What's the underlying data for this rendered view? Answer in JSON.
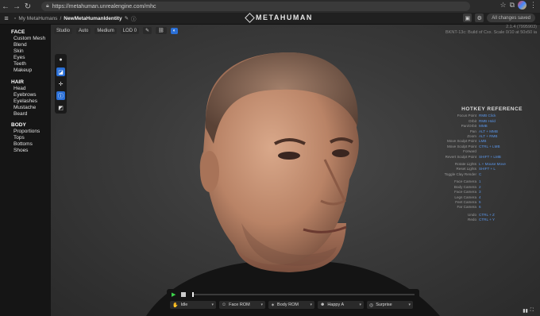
{
  "browser": {
    "url": "https://metahuman.unrealengine.com/mhc",
    "back": "←",
    "forward": "→",
    "reload": "↻",
    "icons": [
      "star-icon",
      "extension-icon",
      "menu-icon"
    ]
  },
  "header": {
    "breadcrumb_root": "My MetaHumans",
    "separator": "/",
    "breadcrumb_current": "NewMetaHumanIdentity",
    "logo": "METAHUMAN",
    "saved_label": "All changes saved"
  },
  "sidebar": {
    "sections": [
      {
        "title": "FACE",
        "items": [
          "Custom Mesh",
          "Blend",
          "Skin",
          "Eyes",
          "Teeth",
          "Makeup"
        ]
      },
      {
        "title": "HAIR",
        "items": [
          "Head",
          "Eyebrows",
          "Eyelashes",
          "Mustache",
          "Beard"
        ]
      },
      {
        "title": "BODY",
        "items": [
          "Proportions",
          "Tops",
          "Bottoms",
          "Shoes"
        ]
      }
    ]
  },
  "viewport_toolbar": {
    "lighting": "Studio",
    "camera": "Auto",
    "quality": "Medium",
    "lod": "LOD 0"
  },
  "version": {
    "line1": "2.1.4 (7995903)",
    "line2": "BKNT-13c: Build of Cxx. Scale 0/10 at 50x50 ia"
  },
  "hotkeys": {
    "title": "HOTKEY REFERENCE",
    "groups": [
      [
        {
          "action": "Focus Point",
          "key": "RMB Click"
        },
        {
          "action": "Orbit",
          "key": "RMB Hold"
        },
        {
          "action": "Pan/Orbit",
          "key": "MMB"
        },
        {
          "action": "Pan",
          "key": "ALT + MMB"
        },
        {
          "action": "Zoom",
          "key": "ALT + RMB"
        },
        {
          "action": "Move Sculpt Point",
          "key": "LMB"
        },
        {
          "action": "Move Sculpt Point Forward",
          "key": "CTRL + LMB"
        },
        {
          "action": "Revert Sculpt Point",
          "key": "SHIFT + LMB"
        }
      ],
      [
        {
          "action": "Rotate Lights",
          "key": "L + Mouse Move"
        },
        {
          "action": "Reset Lights",
          "key": "SHIFT + L"
        },
        {
          "action": "Toggle Clay Render",
          "key": "C"
        }
      ],
      [
        {
          "action": "Face Camera",
          "key": "1"
        },
        {
          "action": "Body Camera",
          "key": "2"
        },
        {
          "action": "Face Camera",
          "key": "3"
        },
        {
          "action": "Legs Camera",
          "key": "4"
        },
        {
          "action": "Feet Camera",
          "key": "5"
        },
        {
          "action": "Far Camera",
          "key": "6"
        }
      ],
      [
        {
          "action": "Undo",
          "key": "CTRL + Z"
        },
        {
          "action": "Redo",
          "key": "CTRL + Y"
        }
      ]
    ]
  },
  "animation": {
    "chips": [
      {
        "label": "Idle",
        "icon": "person-icon"
      },
      {
        "label": "Face ROM",
        "icon": "face-icon"
      },
      {
        "label": "Body ROM",
        "icon": "body-icon"
      },
      {
        "label": "Happy A",
        "icon": "happy-icon"
      },
      {
        "label": "Surprise",
        "icon": "surprise-icon"
      }
    ]
  },
  "colors": {
    "accent": "#2a6fd6",
    "hotkey_key": "#5a95e8",
    "play": "#3cd34a"
  }
}
